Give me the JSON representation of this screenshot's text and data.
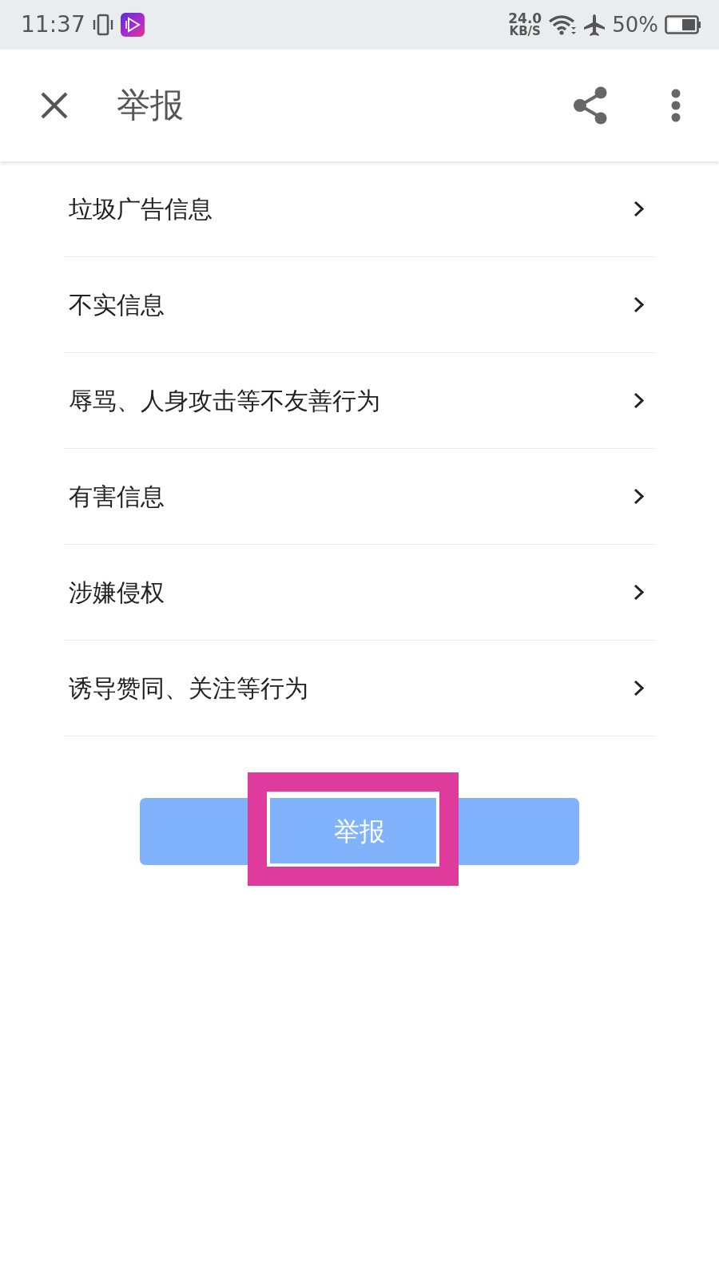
{
  "status_bar": {
    "time": "11:37",
    "net_speed": "24.0",
    "net_unit": "KB/S",
    "battery_text": "50%"
  },
  "toolbar": {
    "title": "举报"
  },
  "reasons": [
    {
      "label": "垃圾广告信息"
    },
    {
      "label": "不实信息"
    },
    {
      "label": "辱骂、人身攻击等不友善行为"
    },
    {
      "label": "有害信息"
    },
    {
      "label": "涉嫌侵权"
    },
    {
      "label": "诱导赞同、关注等行为"
    }
  ],
  "submit_button": {
    "label": "举报"
  },
  "annotation": {
    "highlight_box": true
  }
}
